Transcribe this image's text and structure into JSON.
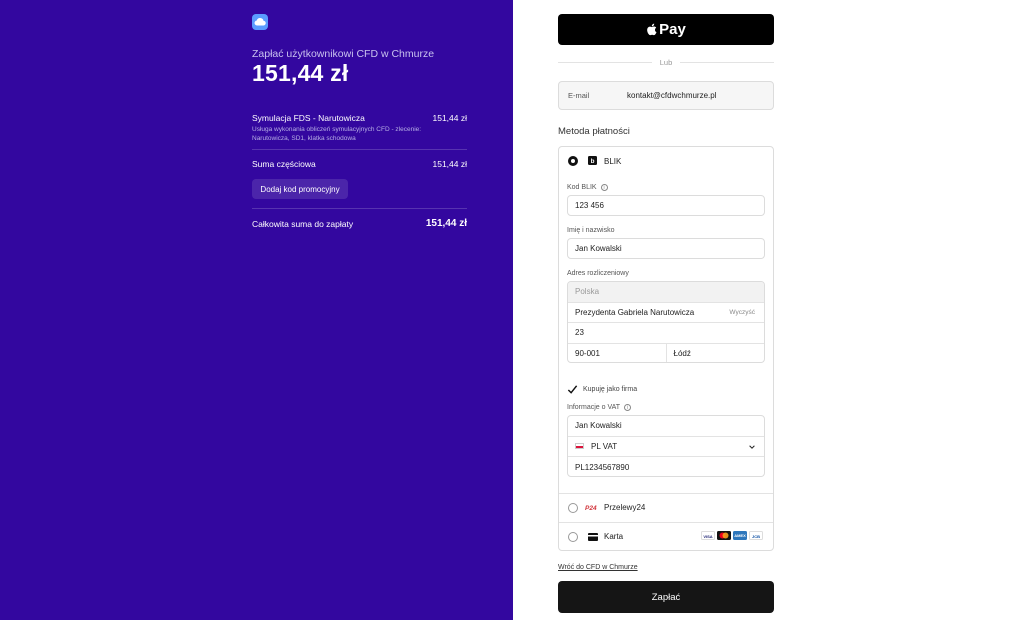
{
  "summary": {
    "pay_to": "Zapłać użytkownikowi CFD w Chmurze",
    "amount": "151,44 zł",
    "item_name": "Symulacja FDS - Narutowicza",
    "item_price": "151,44 zł",
    "item_desc": "Usługa wykonania obliczeń symulacyjnych CFD - zlecenie: Narutowicza, SD1, klatka schodowa",
    "subtotal_label": "Suma częściowa",
    "subtotal_value": "151,44 zł",
    "promo_label": "Dodaj kod promocyjny",
    "total_label": "Całkowita suma do zapłaty",
    "total_value": "151,44 zł"
  },
  "checkout": {
    "apple_pay_label": "Pay",
    "or_label": "Lub",
    "email_label": "E-mail",
    "email_value": "kontakt@cfdwchmurze.pl",
    "method_title": "Metoda płatności",
    "blik": {
      "label": "BLIK",
      "code_label": "Kod BLIK",
      "code_value": "123 456",
      "name_label": "Imię i nazwisko",
      "name_value": "Jan Kowalski",
      "address_label": "Adres rozliczeniowy",
      "country": "Polska",
      "street": "Prezydenta Gabriela Narutowicza",
      "clear_label": "Wyczyść",
      "number": "23",
      "postal": "90-001",
      "city": "Łódź",
      "company_label": "Kupuję jako firma",
      "vat_label": "Informacje o VAT",
      "vat_name": "Jan Kowalski",
      "vat_type": "PL VAT",
      "vat_number": "PL1234567890"
    },
    "przelewy_label": "Przelewy24",
    "card_label": "Karta",
    "card_brands": [
      "VISA",
      "MC",
      "AMEX",
      "JCB"
    ],
    "back_link": "Wróć do CFD w Chmurze",
    "pay_button": "Zapłać"
  },
  "colors": {
    "left_bg": "#33079f",
    "pay_button": "#151515"
  }
}
